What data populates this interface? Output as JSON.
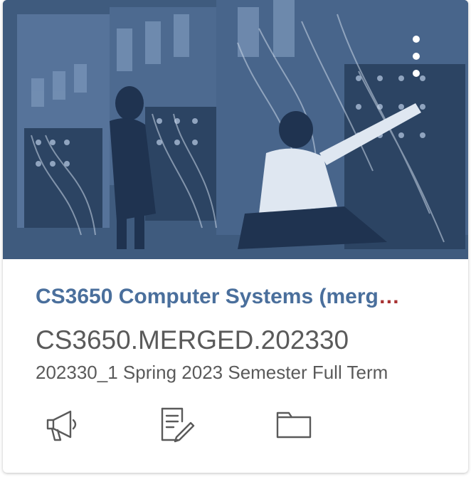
{
  "course": {
    "title": "CS3650 Computer Systems (merg",
    "ellipsis": "…",
    "code": "CS3650.MERGED.202330",
    "term": "202330_1 Spring 2023 Semester Full Term"
  },
  "icons": {
    "options": "vertical-dots-icon",
    "announcements": "megaphone-icon",
    "assignments": "document-pencil-icon",
    "files": "folder-icon"
  },
  "colors": {
    "title": "#4a6f9c",
    "hero_tint": "#415e82",
    "text": "#5a5a5a",
    "ellipsis": "#a83232",
    "icon": "#5a5a5a"
  }
}
